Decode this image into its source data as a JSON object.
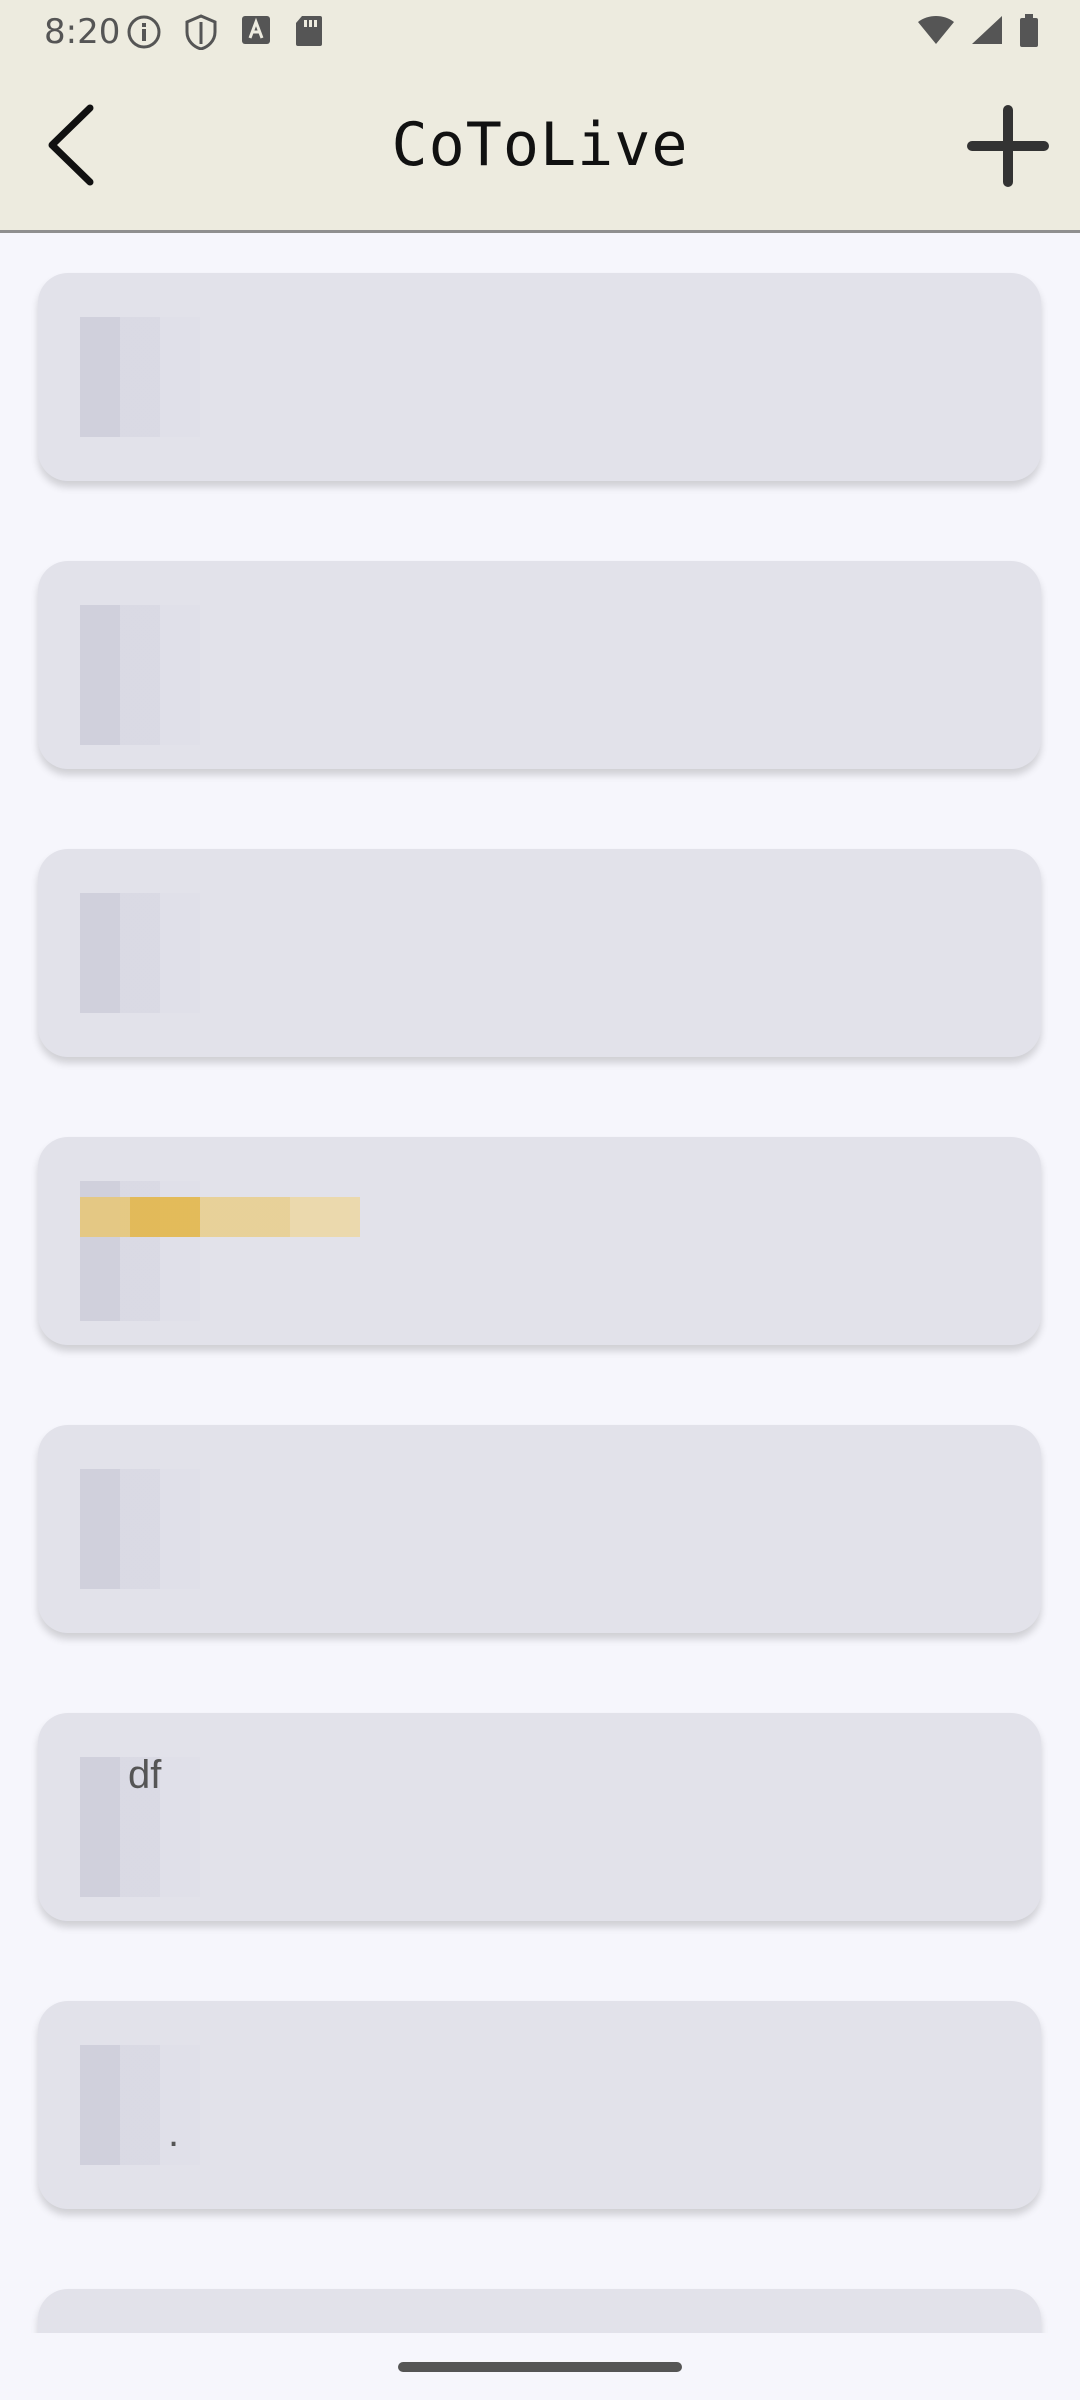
{
  "status_bar": {
    "time": "8:20",
    "left_icons": [
      "info-icon",
      "shield-icon",
      "font-a-icon",
      "sd-card-icon"
    ],
    "right_icons": [
      "wifi-icon",
      "cell-signal-icon",
      "battery-icon"
    ]
  },
  "app_bar": {
    "title": "CoToLive",
    "back_icon": "chevron-left-icon",
    "add_icon": "plus-icon"
  },
  "notes": [
    {
      "text": "",
      "redacted": true
    },
    {
      "text": "",
      "redacted": true
    },
    {
      "text": "",
      "redacted": true
    },
    {
      "text": "",
      "redacted": true,
      "emoji": true
    },
    {
      "text": "",
      "redacted": true
    },
    {
      "text": "df",
      "redacted": true
    },
    {
      "text": ".",
      "redacted": true
    },
    {
      "text": "",
      "redacted": true
    }
  ],
  "colors": {
    "app_bar": "#edebdf",
    "background": "#f6f6fc",
    "card": "#e2e2ea"
  }
}
